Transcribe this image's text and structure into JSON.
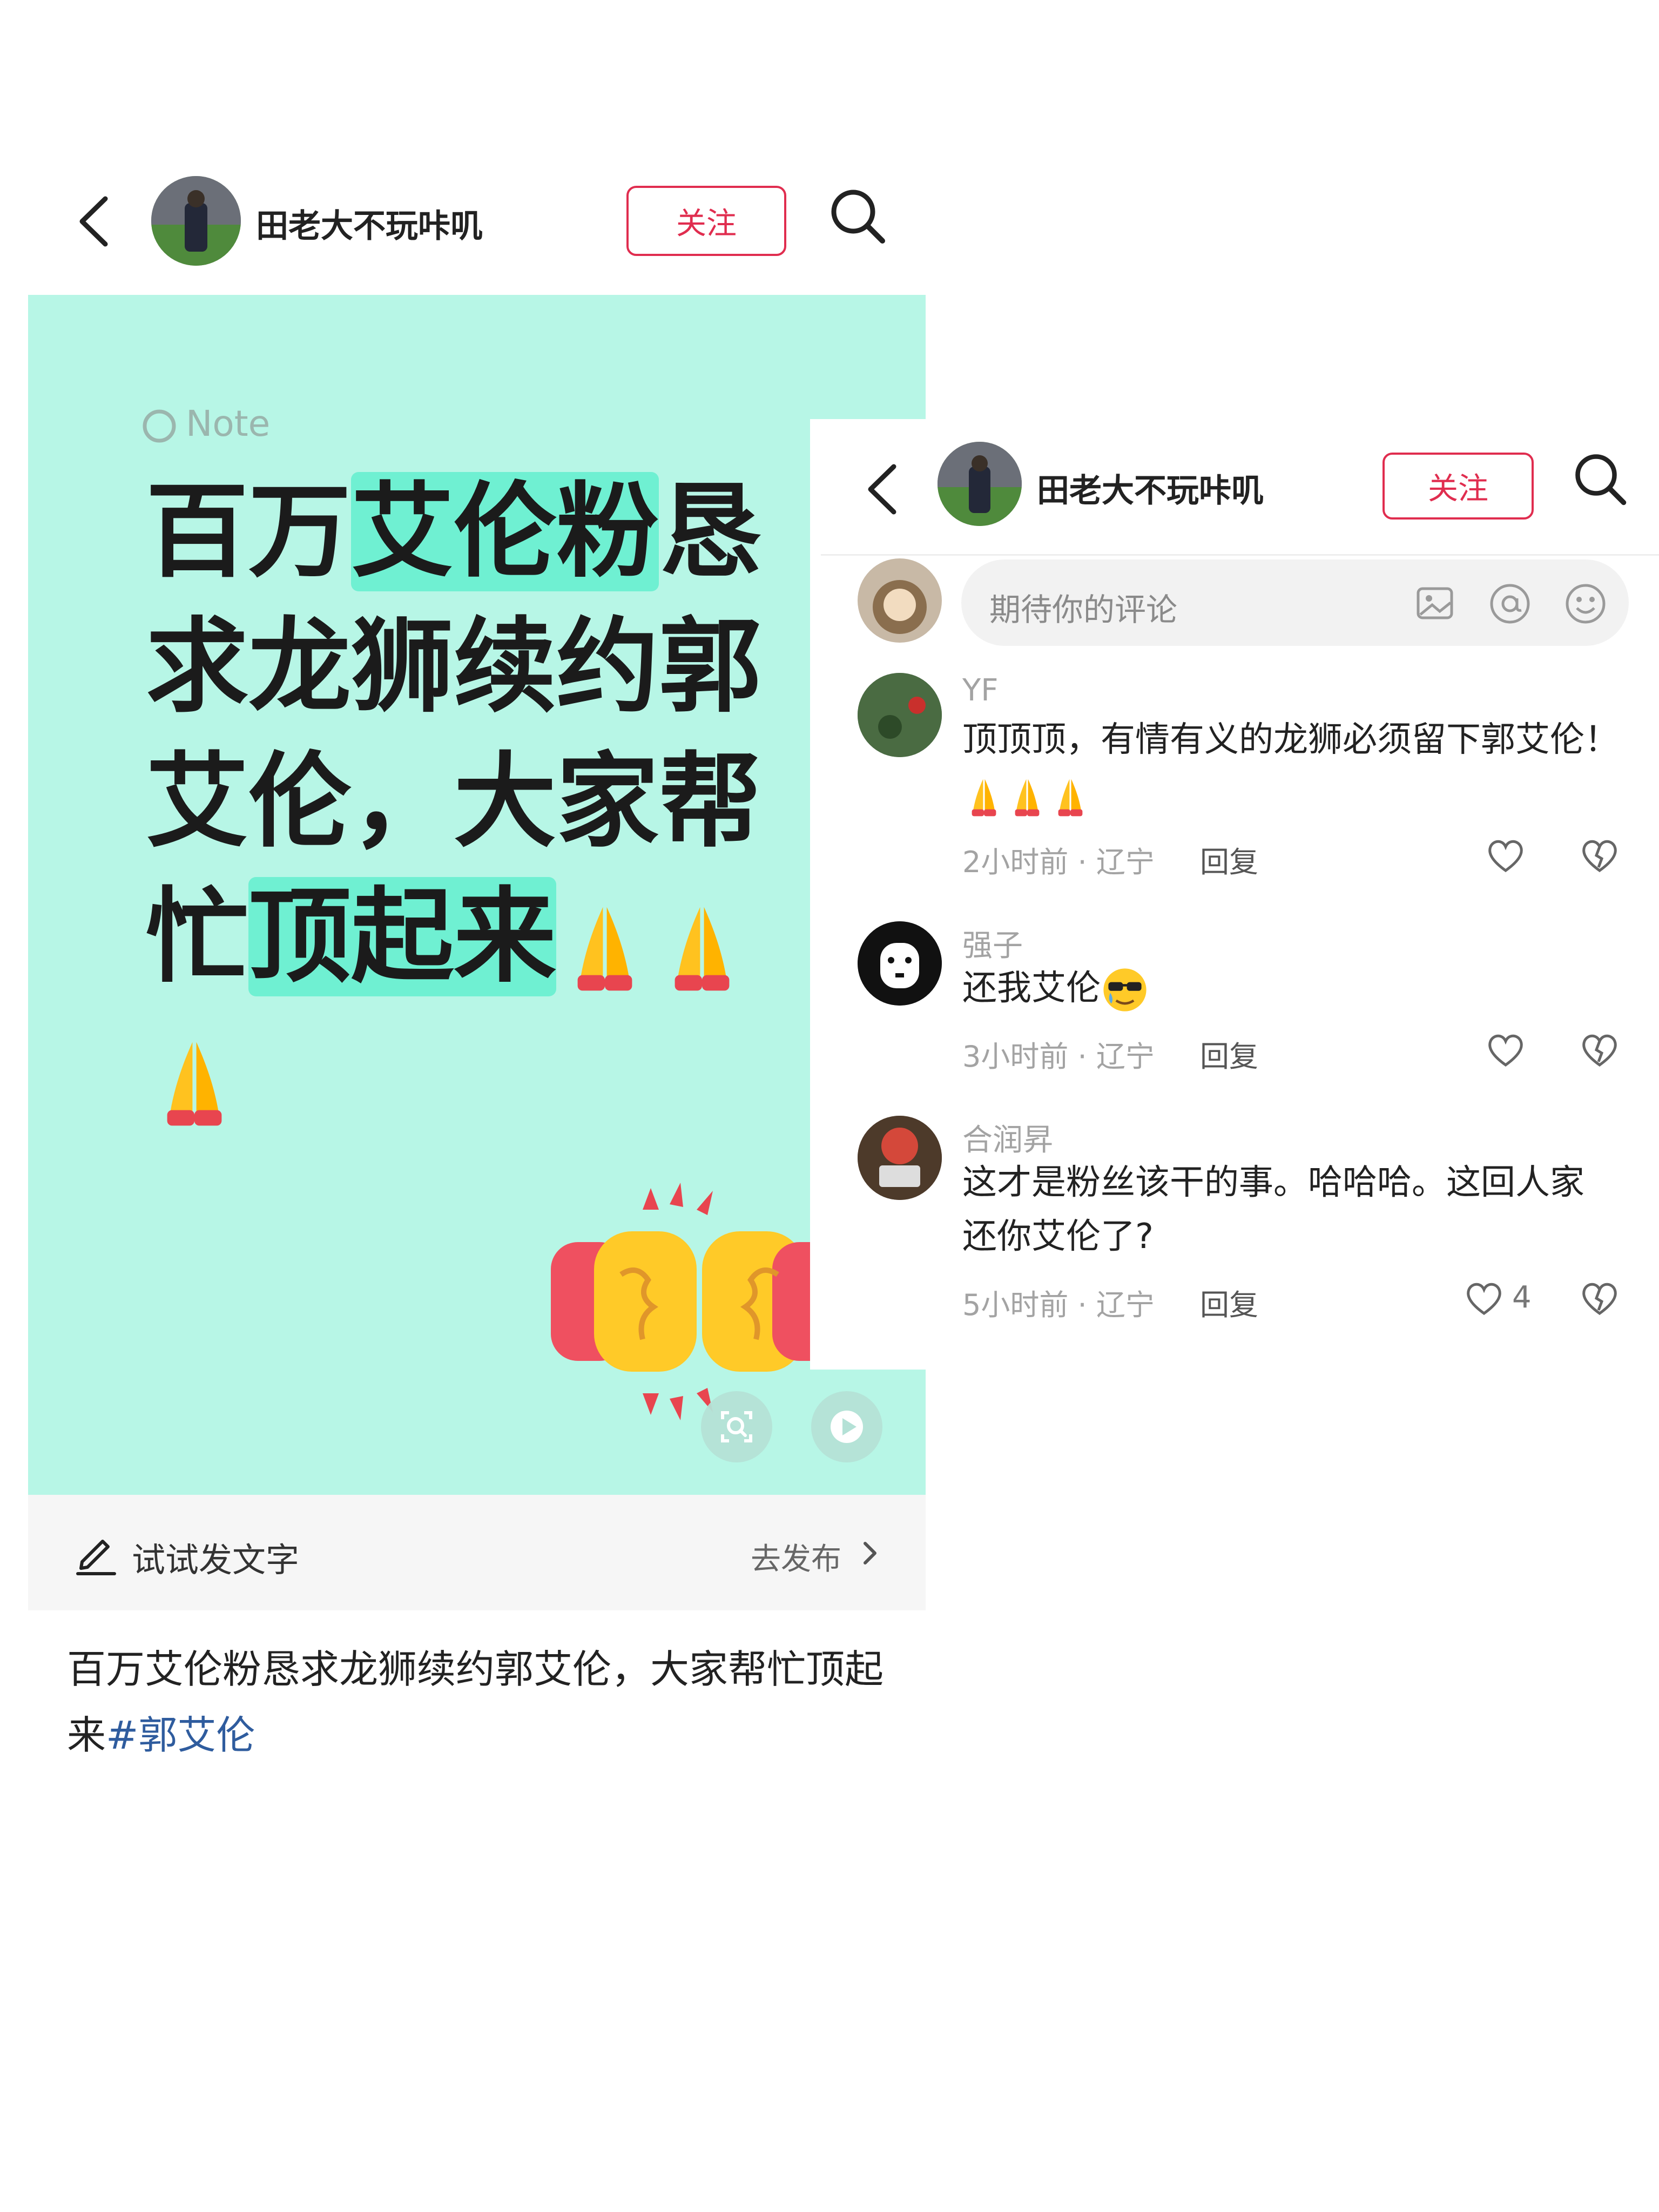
{
  "left_post": {
    "username": "田老大不玩咔叽",
    "follow_label": "关注",
    "note_tag": "Note",
    "title_segments": [
      {
        "text": "百万",
        "hl": false
      },
      {
        "text": "艾伦粉",
        "hl": true
      },
      {
        "text": "恳求龙狮续约郭艾伦，大家帮忙",
        "hl": false
      },
      {
        "text": "顶起来",
        "hl": true
      }
    ],
    "try_label": "试试发文字",
    "publish_label": "去发布",
    "description": "百万艾伦粉恳求龙狮续约郭艾伦，大家帮忙顶起来",
    "hashtag": "#郭艾伦"
  },
  "comments_page": {
    "username": "田老大不玩咔叽",
    "follow_label": "关注",
    "input_placeholder": "期待你的评论",
    "comments": [
      {
        "name": "YF",
        "text": "顶顶顶，有情有义的龙狮必须留下郭艾伦！",
        "time": "2小时前 · 辽宁",
        "reply": "回复",
        "likes": ""
      },
      {
        "name": "强子",
        "text": "还我艾伦",
        "time": "3小时前 · 辽宁",
        "reply": "回复",
        "likes": ""
      },
      {
        "name": "合润昇",
        "text": "这才是粉丝该干的事。哈哈哈。这回人家还你艾伦了?",
        "time": "5小时前 · 辽宁",
        "reply": "回复",
        "likes": "4"
      }
    ]
  },
  "colors": {
    "accent": "#e02d4f",
    "note_bg": "#b7f6e6",
    "highlight": "#6ff0d2",
    "hashtag": "#2f5c9e"
  }
}
